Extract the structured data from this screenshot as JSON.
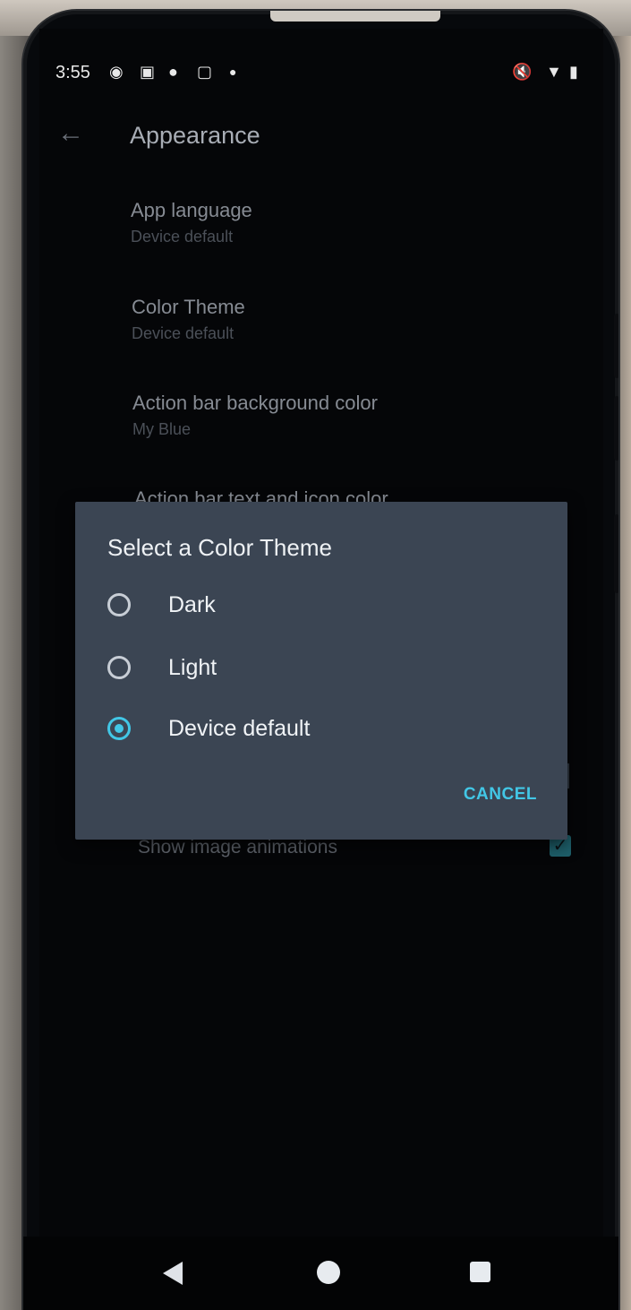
{
  "status_bar": {
    "time": "3:55",
    "icons": [
      "steam-icon",
      "sim-icon",
      "maps-icon",
      "bag-icon",
      "dot-icon",
      "mute-icon",
      "wifi-icon",
      "battery-icon"
    ]
  },
  "toolbar": {
    "back_icon": "back-arrow-icon",
    "title": "Appearance"
  },
  "preferences": [
    {
      "title": "App language",
      "summary": "Device default"
    },
    {
      "title": "Color Theme",
      "summary": "Device default"
    },
    {
      "title": "Action bar background color",
      "summary": "My Blue"
    },
    {
      "title": "Action bar text and icon color",
      "summary": ""
    }
  ],
  "below_dialog": {
    "label": "Show image animations",
    "checked": true
  },
  "dialog": {
    "title": "Select a Color Theme",
    "options": [
      {
        "label": "Dark",
        "selected": false
      },
      {
        "label": "Light",
        "selected": false
      },
      {
        "label": "Device default",
        "selected": true
      }
    ],
    "cancel_label": "CANCEL"
  },
  "navbar": {
    "back": "nav-back-icon",
    "home": "nav-home-icon",
    "recents": "nav-recents-icon"
  },
  "colors": {
    "accent": "#42c7e6",
    "dialog_bg": "#3b4553",
    "screen_bg": "#050608"
  }
}
